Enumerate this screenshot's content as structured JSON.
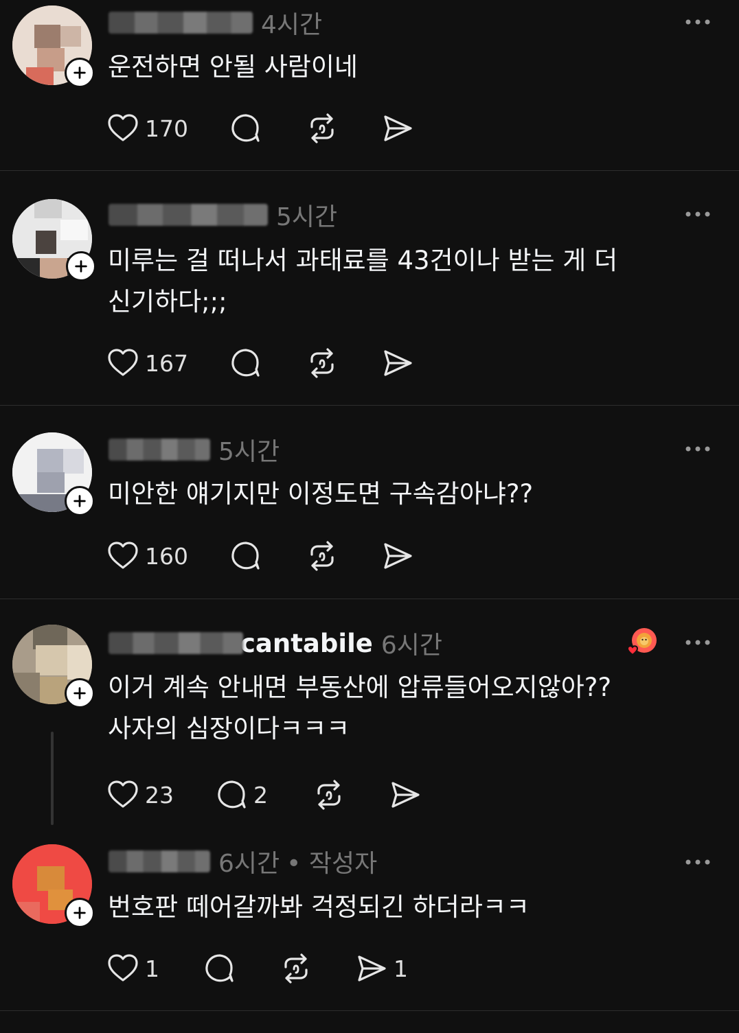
{
  "comments": [
    {
      "username": "",
      "time": "4시간",
      "author_label": "",
      "text_lines": [
        "운전하면 안될 사람이네"
      ],
      "likes": "170",
      "replies": "",
      "shares": ""
    },
    {
      "username": "",
      "time": "5시간",
      "author_label": "",
      "text_lines": [
        "미루는 걸 떠나서 과태료를 43건이나 받는 게 더",
        "신기하다;;;"
      ],
      "likes": "167",
      "replies": "",
      "shares": ""
    },
    {
      "username": "",
      "time": "5시간",
      "author_label": "",
      "text_lines": [
        "미안한 얘기지만 이정도면 구속감아냐??"
      ],
      "likes": "160",
      "replies": "",
      "shares": ""
    },
    {
      "username_fragment": "cantabile",
      "time": "6시간",
      "author_label": "",
      "text_lines": [
        "이거 계속 안내면 부동산에 압류들어오지않아??",
        "사자의 심장이다ㅋㅋㅋ"
      ],
      "likes": "23",
      "replies": "2",
      "shares": ""
    },
    {
      "username": "",
      "time": "6시간",
      "author_label": "• 작성자",
      "text_lines": [
        "번호판 떼어갈까봐 걱정되긴 하더라ㅋㅋ"
      ],
      "likes": "1",
      "replies": "",
      "shares": "1"
    }
  ],
  "icons": {
    "like": "heart-icon",
    "reply": "comment-bubble-icon",
    "repost": "repost-icon",
    "share": "send-icon",
    "more": "more-dots-icon",
    "follow": "plus-icon"
  },
  "colors": {
    "background": "#101010",
    "text": "#f3f5f7",
    "muted": "#777777",
    "divider": "#2e2e2e",
    "reaction_heart": "#ff3040"
  }
}
